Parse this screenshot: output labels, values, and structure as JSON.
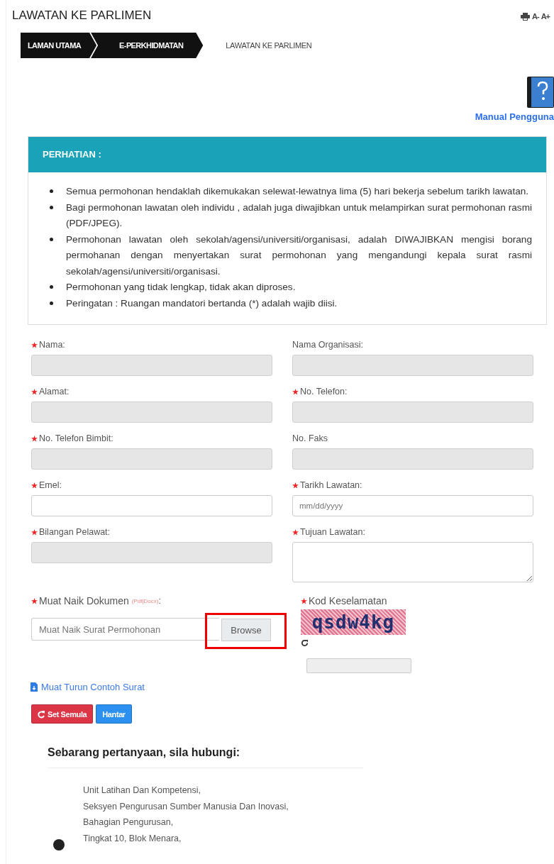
{
  "page_title": "LAWATAN KE PARLIMEN",
  "tools": {
    "font_decrease": "A-",
    "font_increase": "A+"
  },
  "breadcrumb": [
    {
      "label": "LAMAN UTAMA",
      "current": false
    },
    {
      "label": "E-PERKHIDMATAN",
      "current": false
    },
    {
      "label": "LAWATAN KE PARLIMEN",
      "current": true
    }
  ],
  "manual_link": "Manual Pengguna",
  "notice": {
    "title": "PERHATIAN :",
    "items": [
      "Semua permohonan hendaklah dikemukakan selewat-lewatnya lima (5) hari bekerja sebelum tarikh lawatan.",
      "Bagi permohonan lawatan oleh individu , adalah juga diwajibkan untuk melampirkan surat permohonan rasmi (PDF/JPEG).",
      "Permohonan lawatan oleh sekolah/agensi/universiti/organisasi, adalah DIWAJIBKAN mengisi borang permohanan dengan menyertakan surat permohonan yang mengandungi kepala surat rasmi sekolah/agensi/universiti/organisasi.",
      "Permohonan yang tidak lengkap, tidak akan diproses.",
      "Peringatan : Ruangan mandatori bertanda (*) adalah wajib diisi."
    ]
  },
  "fields": [
    {
      "label": "Nama:",
      "required": true,
      "kind": "text",
      "disabled": true
    },
    {
      "label": "Nama Organisasi:",
      "required": false,
      "kind": "text",
      "disabled": true
    },
    {
      "label": "Alamat:",
      "required": true,
      "kind": "text",
      "disabled": true
    },
    {
      "label": "No. Telefon:",
      "required": true,
      "kind": "text",
      "disabled": true
    },
    {
      "label": "No. Telefon Bimbit:",
      "required": true,
      "kind": "text",
      "disabled": true
    },
    {
      "label": "No. Faks",
      "required": false,
      "kind": "text",
      "disabled": true
    },
    {
      "label": "Emel:",
      "required": true,
      "kind": "text",
      "disabled": false
    },
    {
      "label": "Tarikh Lawatan:",
      "required": true,
      "kind": "text",
      "disabled": false,
      "placeholder": "mm/dd/yyyy"
    },
    {
      "label": "Bilangan Pelawat:",
      "required": true,
      "kind": "text",
      "disabled": true
    },
    {
      "label": "Tujuan Lawatan:",
      "required": true,
      "kind": "textarea",
      "disabled": false
    }
  ],
  "upload": {
    "label": "Muat Naik Dokumen",
    "hint": "(Pdf|Docx)",
    "colon": ":",
    "required": true,
    "placeholder": "Muat Naik Surat Permohonan",
    "button": "Browse",
    "highlighted": true
  },
  "captcha": {
    "label": "Kod Keselamatan",
    "required": true,
    "code": "qsdw4kg"
  },
  "download_link": "Muat Turun Contoh Surat",
  "buttons": [
    {
      "label": "Set Semula",
      "kind": "reset"
    },
    {
      "label": "Hantar",
      "kind": "submit"
    }
  ],
  "contact": {
    "heading": "Sebarang pertanyaan, sila hubungi:",
    "lines": [
      "Unit Latihan Dan Kompetensi,",
      "Seksyen Pengurusan Sumber Manusia Dan Inovasi,",
      "Bahagian Pengurusan,",
      "Tingkat 10, Blok Menara,"
    ]
  }
}
